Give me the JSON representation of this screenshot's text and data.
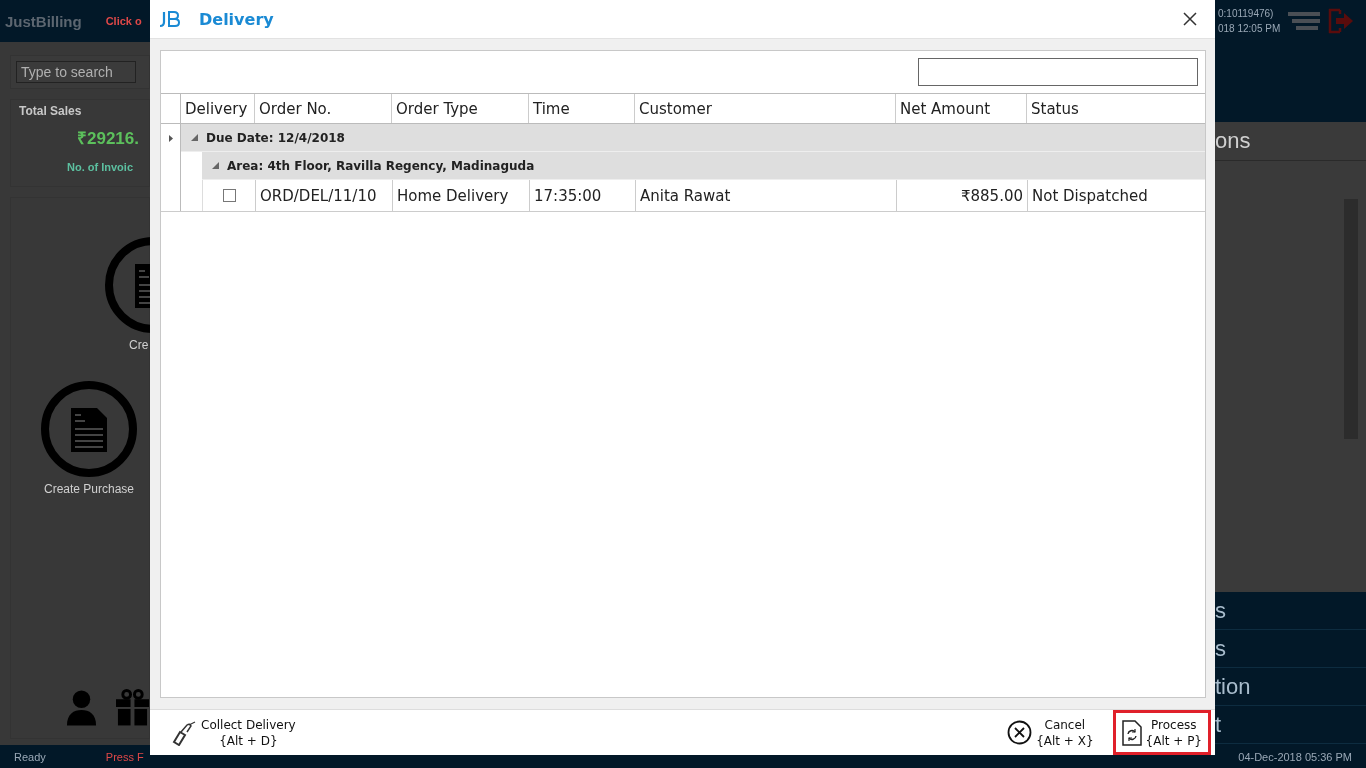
{
  "background": {
    "logo": "JustBilling",
    "header_notice": "Click o",
    "header_info": [
      "0:10119476)",
      "018 12:05 PM"
    ],
    "search": {
      "placeholder": "Type to search"
    },
    "total_sales": {
      "title": "Total Sales",
      "amount": "₹29216.",
      "label": "No. of Invoic"
    },
    "tiles": [
      {
        "label": "Cre"
      },
      {
        "label": "Create Purchase"
      }
    ],
    "panel_title": "ons",
    "menu_items": [
      "s",
      "s",
      "tion",
      "t"
    ],
    "status_bar": {
      "left": "Ready",
      "hint": "Press F",
      "right": "04-Dec-2018 05:36 PM"
    }
  },
  "dialog": {
    "title": "Delivery",
    "columns": [
      "Delivery",
      "Order No.",
      "Order Type",
      "Time",
      "Customer",
      "Net Amount",
      "Status"
    ],
    "groups": [
      {
        "label": "Due Date: 12/4/2018",
        "expanded": true,
        "children": [
          {
            "label": "Area: 4th Floor, Ravilla Regency, Madinaguda",
            "expanded": true,
            "rows": [
              {
                "checked": false,
                "cells": [
                  "ORD/DEL/11/10",
                  "Home Delivery",
                  "17:35:00",
                  "Anita Rawat",
                  "₹885.00",
                  "Not Dispatched"
                ]
              }
            ]
          }
        ]
      }
    ],
    "buttons": [
      {
        "kind": "collect",
        "label": "Collect Delivery",
        "shortcut": "{Alt + D}",
        "selected": false
      },
      {
        "kind": "cancel",
        "label": "Cancel",
        "shortcut": "{Alt + X}",
        "selected": false
      },
      {
        "kind": "process",
        "label": "Process",
        "shortcut": "{Alt + P}",
        "selected": true
      }
    ]
  }
}
